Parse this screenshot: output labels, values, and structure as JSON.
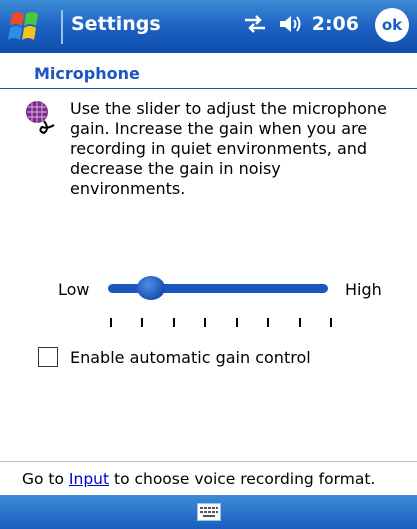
{
  "titlebar": {
    "title": "Settings",
    "clock": "2:06",
    "ok_label": "ok",
    "icons": [
      "windows-start-icon",
      "connectivity-icon",
      "speaker-icon"
    ]
  },
  "page": {
    "title": "Microphone",
    "description": "Use the slider to adjust the microphone gain. Increase the gain when you are recording in quiet environments, and decrease the gain in noisy environments."
  },
  "slider": {
    "low_label": "Low",
    "high_label": "High",
    "value_fraction": 0.15,
    "tick_count": 8
  },
  "agc": {
    "label": "Enable automatic gain control",
    "checked": false
  },
  "footer": {
    "prefix": "Go to ",
    "link": "Input",
    "suffix": " to choose voice recording format."
  },
  "colors": {
    "accent": "#1a55c0",
    "bar": "#1a5fc0",
    "link": "#0000d0"
  }
}
